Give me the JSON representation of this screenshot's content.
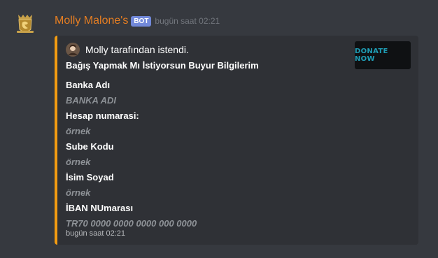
{
  "message": {
    "username": "Molly Malone's",
    "bot_tag": "BOT",
    "timestamp": "bugün saat 02:21",
    "avatar_icon": "gold-crest-logo-icon"
  },
  "embed": {
    "accent_color": "#f39c12",
    "author": {
      "name": "Molly tarafından istendi.",
      "icon": "user-avatar-icon"
    },
    "thumbnail_text": "DONATE NOW",
    "title": "Bağış Yapmak Mı İstiyorsun Buyur Bilgilerim",
    "fields": [
      {
        "name": "Banka Adı",
        "value": "BANKA ADI"
      },
      {
        "name": "Hesap numarasi:",
        "value": "örnek"
      },
      {
        "name": "Sube Kodu",
        "value": "örnek"
      },
      {
        "name": "İsim Soyad",
        "value": "örnek"
      },
      {
        "name": "İBAN NUmarası",
        "value": "TR70 0000 0000 0000 000 0000"
      }
    ],
    "footer": "bugün saat 02:21"
  }
}
